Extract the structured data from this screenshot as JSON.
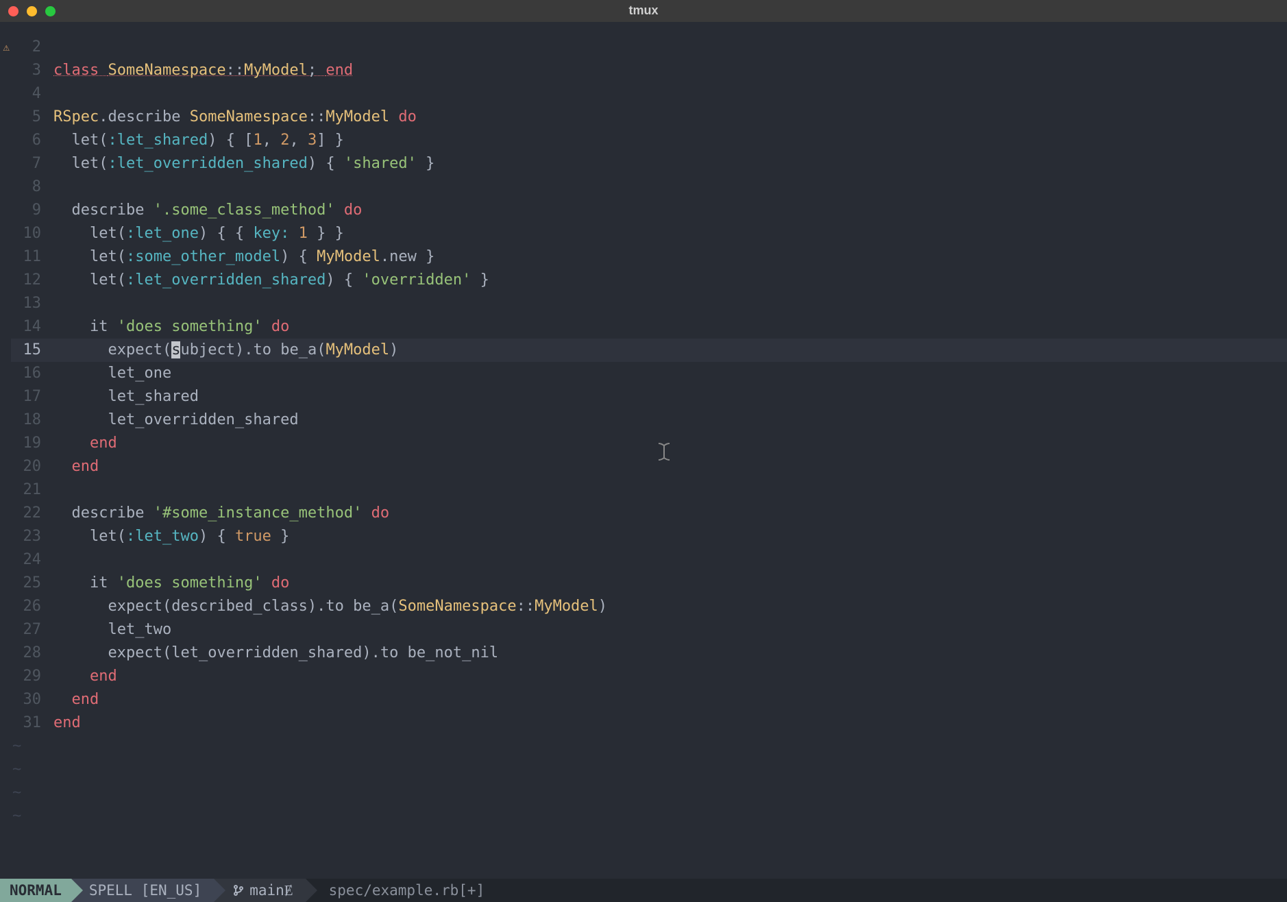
{
  "window_title": "tmux",
  "cursor_line": 15,
  "code_lines": [
    {
      "n": 2,
      "sign": "",
      "tokens": []
    },
    {
      "n": 3,
      "sign": "⚠",
      "tokens": [
        {
          "t": "class ",
          "c": "tok-kw tok-und"
        },
        {
          "t": "SomeNamespace",
          "c": "tok-class tok-und"
        },
        {
          "t": "::",
          "c": "tok-punc tok-und"
        },
        {
          "t": "MyModel",
          "c": "tok-class tok-und"
        },
        {
          "t": "; ",
          "c": "tok-punc tok-und"
        },
        {
          "t": "end",
          "c": "tok-kw tok-und"
        }
      ]
    },
    {
      "n": 4,
      "sign": "",
      "tokens": []
    },
    {
      "n": 5,
      "sign": "",
      "tokens": [
        {
          "t": "RSpec",
          "c": "tok-const"
        },
        {
          "t": ".",
          "c": "tok-punc"
        },
        {
          "t": "describe ",
          "c": "tok-var"
        },
        {
          "t": "SomeNamespace",
          "c": "tok-class"
        },
        {
          "t": "::",
          "c": "tok-punc"
        },
        {
          "t": "MyModel ",
          "c": "tok-class"
        },
        {
          "t": "do",
          "c": "tok-kw"
        }
      ]
    },
    {
      "n": 6,
      "sign": "",
      "tokens": [
        {
          "t": "  ",
          "c": ""
        },
        {
          "t": "let",
          "c": "tok-var"
        },
        {
          "t": "(",
          "c": "tok-punc"
        },
        {
          "t": ":let_shared",
          "c": "tok-sym"
        },
        {
          "t": ") { [",
          "c": "tok-punc"
        },
        {
          "t": "1",
          "c": "tok-num"
        },
        {
          "t": ", ",
          "c": "tok-punc"
        },
        {
          "t": "2",
          "c": "tok-num"
        },
        {
          "t": ", ",
          "c": "tok-punc"
        },
        {
          "t": "3",
          "c": "tok-num"
        },
        {
          "t": "] }",
          "c": "tok-punc"
        }
      ]
    },
    {
      "n": 7,
      "sign": "",
      "tokens": [
        {
          "t": "  ",
          "c": ""
        },
        {
          "t": "let",
          "c": "tok-var"
        },
        {
          "t": "(",
          "c": "tok-punc"
        },
        {
          "t": ":let_overridden_shared",
          "c": "tok-sym"
        },
        {
          "t": ") { ",
          "c": "tok-punc"
        },
        {
          "t": "'shared'",
          "c": "tok-str"
        },
        {
          "t": " }",
          "c": "tok-punc"
        }
      ]
    },
    {
      "n": 8,
      "sign": "",
      "tokens": []
    },
    {
      "n": 9,
      "sign": "",
      "tokens": [
        {
          "t": "  ",
          "c": ""
        },
        {
          "t": "describe ",
          "c": "tok-var"
        },
        {
          "t": "'.some_class_method'",
          "c": "tok-str"
        },
        {
          "t": " ",
          "c": ""
        },
        {
          "t": "do",
          "c": "tok-kw"
        }
      ]
    },
    {
      "n": 10,
      "sign": "",
      "tokens": [
        {
          "t": "    ",
          "c": ""
        },
        {
          "t": "let",
          "c": "tok-var"
        },
        {
          "t": "(",
          "c": "tok-punc"
        },
        {
          "t": ":let_one",
          "c": "tok-sym"
        },
        {
          "t": ") { { ",
          "c": "tok-punc"
        },
        {
          "t": "key:",
          "c": "tok-sym"
        },
        {
          "t": " ",
          "c": ""
        },
        {
          "t": "1",
          "c": "tok-num"
        },
        {
          "t": " } }",
          "c": "tok-punc"
        }
      ]
    },
    {
      "n": 11,
      "sign": "",
      "tokens": [
        {
          "t": "    ",
          "c": ""
        },
        {
          "t": "let",
          "c": "tok-var"
        },
        {
          "t": "(",
          "c": "tok-punc"
        },
        {
          "t": ":some_other_model",
          "c": "tok-sym"
        },
        {
          "t": ") { ",
          "c": "tok-punc"
        },
        {
          "t": "MyModel",
          "c": "tok-class"
        },
        {
          "t": ".",
          "c": "tok-punc"
        },
        {
          "t": "new",
          "c": "tok-var"
        },
        {
          "t": " }",
          "c": "tok-punc"
        }
      ]
    },
    {
      "n": 12,
      "sign": "",
      "tokens": [
        {
          "t": "    ",
          "c": ""
        },
        {
          "t": "let",
          "c": "tok-var"
        },
        {
          "t": "(",
          "c": "tok-punc"
        },
        {
          "t": ":let_overridden_shared",
          "c": "tok-sym"
        },
        {
          "t": ") { ",
          "c": "tok-punc"
        },
        {
          "t": "'overridden'",
          "c": "tok-str"
        },
        {
          "t": " }",
          "c": "tok-punc"
        }
      ]
    },
    {
      "n": 13,
      "sign": "",
      "tokens": []
    },
    {
      "n": 14,
      "sign": "",
      "tokens": [
        {
          "t": "    ",
          "c": ""
        },
        {
          "t": "it ",
          "c": "tok-var"
        },
        {
          "t": "'does something'",
          "c": "tok-str"
        },
        {
          "t": " ",
          "c": ""
        },
        {
          "t": "do",
          "c": "tok-kw"
        }
      ]
    },
    {
      "n": 15,
      "sign": "",
      "cursor_in_token": 4,
      "cursor_char": 0,
      "tokens": [
        {
          "t": "      ",
          "c": ""
        },
        {
          "t": "expect",
          "c": "tok-var"
        },
        {
          "t": "(",
          "c": "tok-punc"
        },
        {
          "t": "s",
          "c": "cursor-block"
        },
        {
          "t": "ubject",
          "c": "tok-var"
        },
        {
          "t": ").",
          "c": "tok-punc"
        },
        {
          "t": "to ",
          "c": "tok-var"
        },
        {
          "t": "be_a",
          "c": "tok-var"
        },
        {
          "t": "(",
          "c": "tok-punc"
        },
        {
          "t": "MyModel",
          "c": "tok-class"
        },
        {
          "t": ")",
          "c": "tok-punc"
        }
      ]
    },
    {
      "n": 16,
      "sign": "",
      "tokens": [
        {
          "t": "      ",
          "c": ""
        },
        {
          "t": "let_one",
          "c": "tok-var"
        }
      ]
    },
    {
      "n": 17,
      "sign": "",
      "tokens": [
        {
          "t": "      ",
          "c": ""
        },
        {
          "t": "let_shared",
          "c": "tok-var"
        }
      ]
    },
    {
      "n": 18,
      "sign": "",
      "tokens": [
        {
          "t": "      ",
          "c": ""
        },
        {
          "t": "let_overridden_shared",
          "c": "tok-var"
        }
      ]
    },
    {
      "n": 19,
      "sign": "",
      "tokens": [
        {
          "t": "    ",
          "c": ""
        },
        {
          "t": "end",
          "c": "tok-kw"
        }
      ]
    },
    {
      "n": 20,
      "sign": "",
      "tokens": [
        {
          "t": "  ",
          "c": ""
        },
        {
          "t": "end",
          "c": "tok-kw"
        }
      ]
    },
    {
      "n": 21,
      "sign": "",
      "tokens": []
    },
    {
      "n": 22,
      "sign": "",
      "tokens": [
        {
          "t": "  ",
          "c": ""
        },
        {
          "t": "describe ",
          "c": "tok-var"
        },
        {
          "t": "'#some_instance_method'",
          "c": "tok-str"
        },
        {
          "t": " ",
          "c": ""
        },
        {
          "t": "do",
          "c": "tok-kw"
        }
      ]
    },
    {
      "n": 23,
      "sign": "",
      "tokens": [
        {
          "t": "    ",
          "c": ""
        },
        {
          "t": "let",
          "c": "tok-var"
        },
        {
          "t": "(",
          "c": "tok-punc"
        },
        {
          "t": ":let_two",
          "c": "tok-sym"
        },
        {
          "t": ") { ",
          "c": "tok-punc"
        },
        {
          "t": "true",
          "c": "tok-bool"
        },
        {
          "t": " }",
          "c": "tok-punc"
        }
      ]
    },
    {
      "n": 24,
      "sign": "",
      "tokens": []
    },
    {
      "n": 25,
      "sign": "",
      "tokens": [
        {
          "t": "    ",
          "c": ""
        },
        {
          "t": "it ",
          "c": "tok-var"
        },
        {
          "t": "'does something'",
          "c": "tok-str"
        },
        {
          "t": " ",
          "c": ""
        },
        {
          "t": "do",
          "c": "tok-kw"
        }
      ]
    },
    {
      "n": 26,
      "sign": "",
      "tokens": [
        {
          "t": "      ",
          "c": ""
        },
        {
          "t": "expect",
          "c": "tok-var"
        },
        {
          "t": "(",
          "c": "tok-punc"
        },
        {
          "t": "described_class",
          "c": "tok-var"
        },
        {
          "t": ").",
          "c": "tok-punc"
        },
        {
          "t": "to ",
          "c": "tok-var"
        },
        {
          "t": "be_a",
          "c": "tok-var"
        },
        {
          "t": "(",
          "c": "tok-punc"
        },
        {
          "t": "SomeNamespace",
          "c": "tok-class"
        },
        {
          "t": "::",
          "c": "tok-punc"
        },
        {
          "t": "MyModel",
          "c": "tok-class"
        },
        {
          "t": ")",
          "c": "tok-punc"
        }
      ]
    },
    {
      "n": 27,
      "sign": "",
      "tokens": [
        {
          "t": "      ",
          "c": ""
        },
        {
          "t": "let_two",
          "c": "tok-var"
        }
      ]
    },
    {
      "n": 28,
      "sign": "",
      "tokens": [
        {
          "t": "      ",
          "c": ""
        },
        {
          "t": "expect",
          "c": "tok-var"
        },
        {
          "t": "(",
          "c": "tok-punc"
        },
        {
          "t": "let_overridden_shared",
          "c": "tok-var"
        },
        {
          "t": ").",
          "c": "tok-punc"
        },
        {
          "t": "to ",
          "c": "tok-var"
        },
        {
          "t": "be_not_nil",
          "c": "tok-var"
        }
      ]
    },
    {
      "n": 29,
      "sign": "",
      "tokens": [
        {
          "t": "    ",
          "c": ""
        },
        {
          "t": "end",
          "c": "tok-kw"
        }
      ]
    },
    {
      "n": 30,
      "sign": "",
      "tokens": [
        {
          "t": "  ",
          "c": ""
        },
        {
          "t": "end",
          "c": "tok-kw"
        }
      ]
    },
    {
      "n": 31,
      "sign": "",
      "tokens": [
        {
          "t": "end",
          "c": "tok-kw"
        }
      ]
    }
  ],
  "empty_tilde_rows": 4,
  "statusbar": {
    "mode": "NORMAL",
    "spell": "SPELL [EN_US]",
    "branch": "mainɆ",
    "file": "spec/example.rb[+]"
  }
}
